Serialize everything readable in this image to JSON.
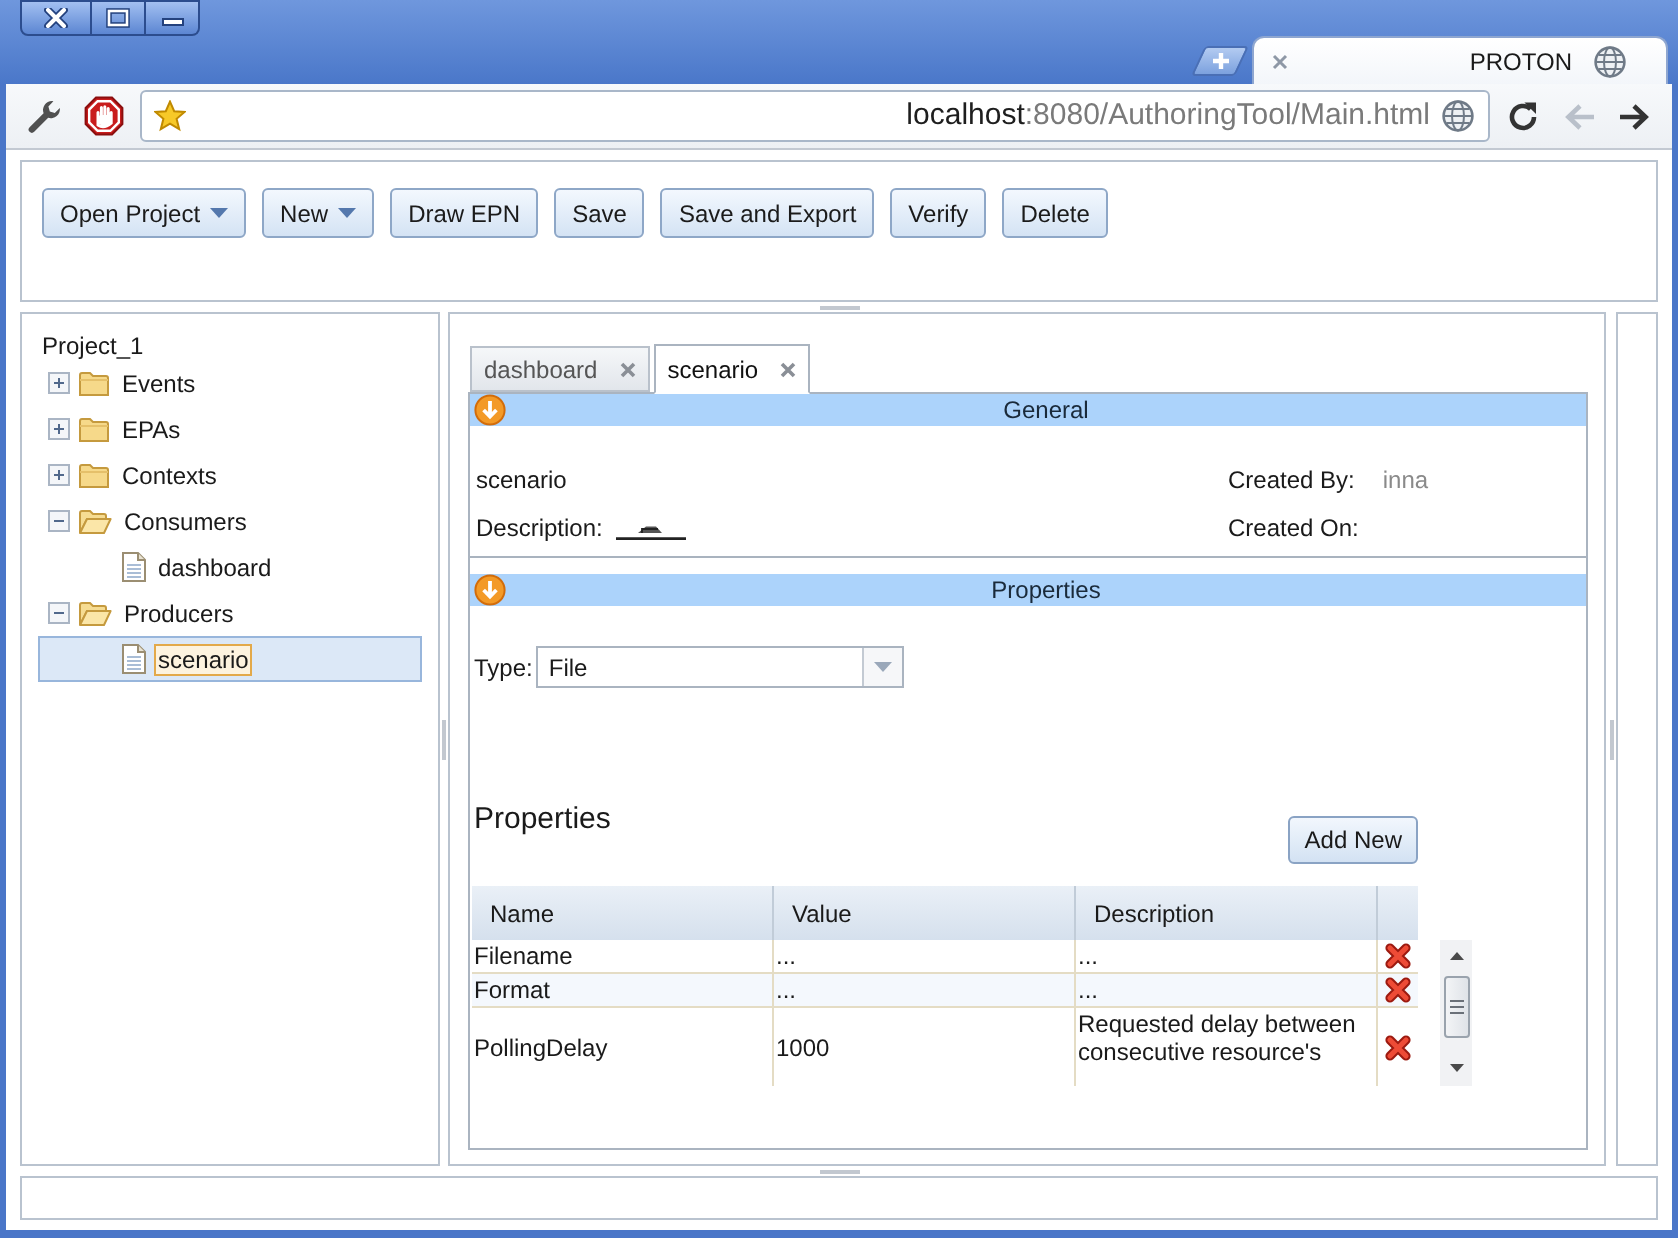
{
  "browser": {
    "tabs": [
      {
        "title": "PROTON",
        "selected": true
      }
    ],
    "address": {
      "host": "localhost",
      "path": ":8080/AuthoringTool/Main.html"
    },
    "back": {
      "disabled": true
    },
    "forward": {
      "disabled": false
    }
  },
  "toolbar": [
    {
      "label": "Open Project",
      "menu": true
    },
    {
      "label": "New",
      "menu": true
    },
    {
      "label": "Draw EPN",
      "menu": false
    },
    {
      "label": "Save",
      "menu": false
    },
    {
      "label": "Save and Export",
      "menu": false
    },
    {
      "label": "Verify",
      "menu": false
    },
    {
      "label": "Delete",
      "menu": false
    }
  ],
  "tree": {
    "label": "Project_1",
    "selected": false,
    "children": [
      {
        "label": "Events",
        "kind": "folder",
        "expanded": false,
        "selected": false
      },
      {
        "label": "EPAs",
        "kind": "folder",
        "expanded": false,
        "selected": false
      },
      {
        "label": "Contexts",
        "kind": "folder",
        "expanded": false,
        "selected": false
      },
      {
        "label": "Consumers",
        "kind": "folder",
        "expanded": true,
        "selected": false,
        "children": [
          {
            "label": "dashboard",
            "kind": "file",
            "selected": false
          }
        ]
      },
      {
        "label": "Producers",
        "kind": "folder",
        "expanded": true,
        "selected": false,
        "children": [
          {
            "label": "scenario",
            "kind": "file",
            "selected": true
          }
        ]
      }
    ]
  },
  "editor": {
    "tabs": [
      {
        "label": "dashboard",
        "selected": false
      },
      {
        "label": "scenario",
        "selected": true
      }
    ],
    "general": {
      "title": "General",
      "name": "scenario",
      "description_label": "Description:",
      "created_by_label": "Created By:",
      "created_by": "inna",
      "created_on_label": "Created On:"
    },
    "properties": {
      "title": "Properties",
      "type_label": "Type:",
      "type_value": "File",
      "heading": "Properties",
      "add_button": "Add New",
      "columns": [
        "Name",
        "Value",
        "Description"
      ],
      "rows": [
        {
          "name": "Filename",
          "value": "...",
          "description": "..."
        },
        {
          "name": "Format",
          "value": "...",
          "description": "..."
        },
        {
          "name": "PollingDelay",
          "value": "1000",
          "description": "Requested delay between consecutive resource's"
        }
      ]
    }
  }
}
